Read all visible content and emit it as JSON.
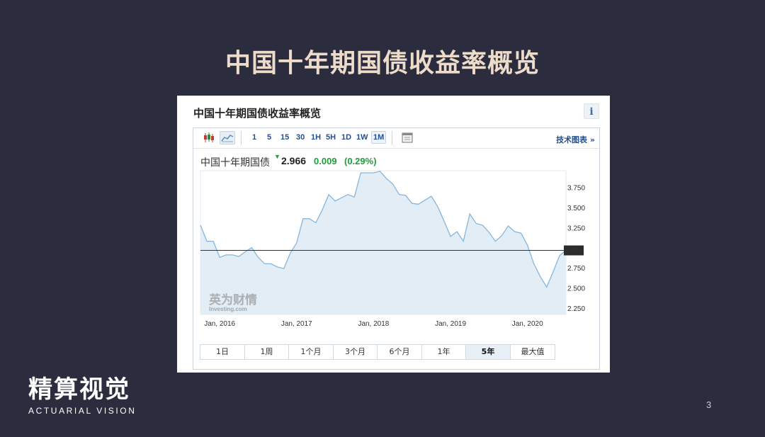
{
  "slide": {
    "title": "中国十年期国债收益率概览",
    "page_number": "3"
  },
  "logo": {
    "name_cn": "精算视觉",
    "name_en": "ACTUARIAL VISION"
  },
  "widget": {
    "title": "中国十年期国债收益率概览",
    "info_label": "i",
    "toolbar": {
      "icons": [
        "candlestick-chart-icon",
        "area-chart-icon",
        "calendar-icon"
      ],
      "timeframes": [
        "1",
        "5",
        "15",
        "30",
        "1H",
        "5H",
        "1D",
        "1W",
        "1M"
      ],
      "active_timeframe": "1M",
      "tech_link": "技术图表 »"
    },
    "quote": {
      "name": "中国十年期国债",
      "price": "2.966",
      "change": "0.009",
      "change_pct": "(0.29%)",
      "up_color": "#1e9e3a"
    },
    "watermark": {
      "cn": "英为财情",
      "en": "Investing.com"
    },
    "ranges": [
      "1日",
      "1周",
      "1个月",
      "3个月",
      "6个月",
      "1年",
      "5年",
      "最大值"
    ],
    "active_range": "5年"
  },
  "chart_data": {
    "type": "area",
    "title": "",
    "xlabel": "",
    "ylabel": "",
    "x_ticks": [
      "Jan, 2016",
      "Jan, 2017",
      "Jan, 2018",
      "Jan, 2019",
      "Jan, 2020"
    ],
    "y_ticks": [
      "3.750",
      "3.500",
      "3.250",
      "2.966",
      "2.750",
      "2.500",
      "2.250"
    ],
    "ylim": [
      2.25,
      4.0
    ],
    "xlim": [
      "2015-10",
      "2020-07"
    ],
    "current_value": 2.966,
    "current_label": "2.966",
    "line_color": "#86b6dc",
    "fill_color": "#e3edf5",
    "grid": false,
    "series": [
      {
        "x": [
          "2015-10",
          "2015-11",
          "2015-12",
          "2016-01",
          "2016-02",
          "2016-03",
          "2016-04",
          "2016-05",
          "2016-06",
          "2016-07",
          "2016-08",
          "2016-09",
          "2016-10",
          "2016-11",
          "2016-12",
          "2017-01",
          "2017-02",
          "2017-03",
          "2017-04",
          "2017-05",
          "2017-06",
          "2017-07",
          "2017-08",
          "2017-09",
          "2017-10",
          "2017-11",
          "2017-12",
          "2018-01",
          "2018-02",
          "2018-03",
          "2018-04",
          "2018-05",
          "2018-06",
          "2018-07",
          "2018-08",
          "2018-09",
          "2018-10",
          "2018-11",
          "2018-12",
          "2019-01",
          "2019-02",
          "2019-03",
          "2019-04",
          "2019-05",
          "2019-06",
          "2019-07",
          "2019-08",
          "2019-09",
          "2019-10",
          "2019-11",
          "2019-12",
          "2020-01",
          "2020-02",
          "2020-03",
          "2020-04",
          "2020-05",
          "2020-06",
          "2020-07"
        ],
        "values": [
          3.28,
          3.08,
          3.08,
          2.88,
          2.91,
          2.91,
          2.89,
          2.95,
          3.0,
          2.88,
          2.8,
          2.8,
          2.76,
          2.74,
          2.93,
          3.06,
          3.36,
          3.36,
          3.31,
          3.47,
          3.66,
          3.58,
          3.62,
          3.66,
          3.63,
          3.93,
          3.93,
          3.93,
          3.95,
          3.86,
          3.79,
          3.66,
          3.65,
          3.55,
          3.54,
          3.59,
          3.64,
          3.51,
          3.33,
          3.14,
          3.2,
          3.08,
          3.42,
          3.3,
          3.28,
          3.19,
          3.08,
          3.15,
          3.27,
          3.2,
          3.18,
          3.03,
          2.8,
          2.64,
          2.51,
          2.7,
          2.9,
          2.97
        ]
      }
    ]
  }
}
